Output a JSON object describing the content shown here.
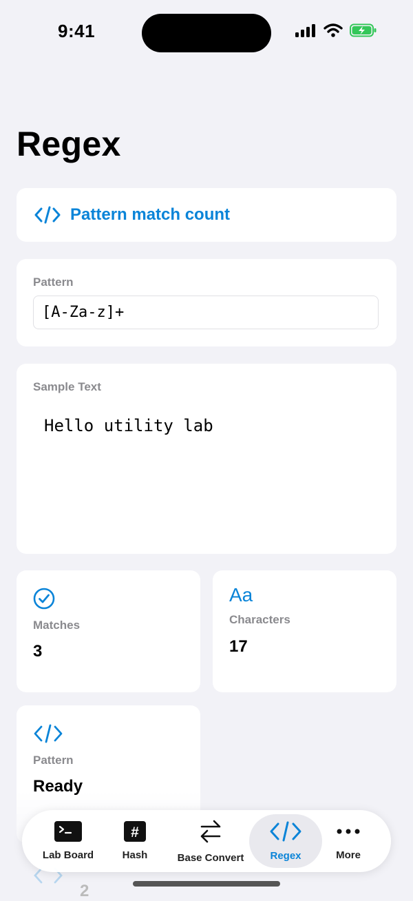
{
  "status_bar": {
    "time": "9:41"
  },
  "page": {
    "title": "Regex"
  },
  "link_card": {
    "label": "Pattern match count",
    "icon": "code-icon",
    "accent": "#0a84d8"
  },
  "pattern_section": {
    "label": "Pattern",
    "value": "[A-Za-z]+"
  },
  "sample_section": {
    "label": "Sample Text",
    "value": "Hello utility lab"
  },
  "stats": {
    "matches": {
      "icon": "checkmark-circle-icon",
      "label": "Matches",
      "value": "3"
    },
    "characters": {
      "icon": "Aa",
      "label": "Characters",
      "value": "17"
    },
    "pattern": {
      "icon": "code-icon",
      "label": "Pattern",
      "value": "Ready"
    }
  },
  "tab_bar": {
    "items": [
      {
        "label": "Lab Board",
        "icon": "terminal-icon",
        "active": false
      },
      {
        "label": "Hash",
        "icon": "hash-icon",
        "active": false
      },
      {
        "label": "Base Convert",
        "icon": "arrows-left-right-icon",
        "active": false
      },
      {
        "label": "Regex",
        "icon": "code-icon",
        "active": true
      },
      {
        "label": "More",
        "icon": "ellipsis-icon",
        "active": false
      }
    ]
  },
  "ghost": {
    "value": "2"
  }
}
